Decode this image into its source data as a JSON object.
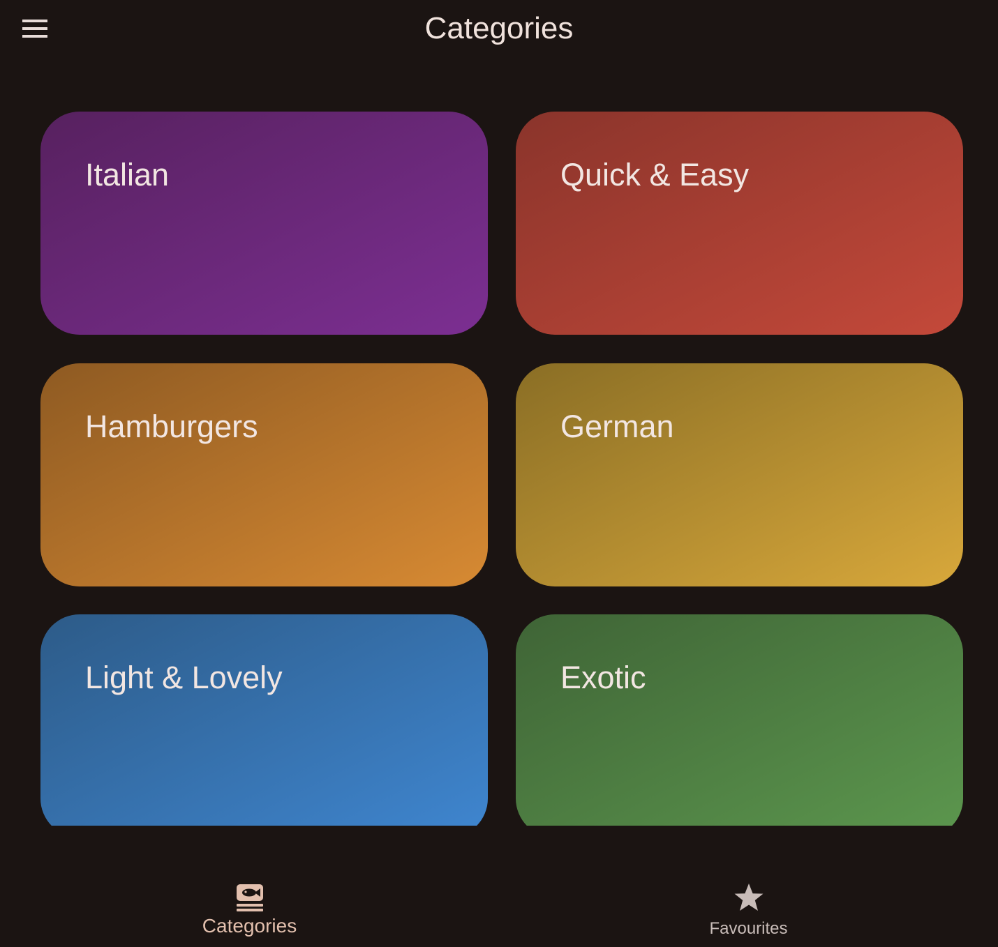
{
  "appbar": {
    "title": "Categories",
    "menu_icon": "menu-icon"
  },
  "categories": [
    {
      "label": "Italian",
      "colors": [
        "#57215f",
        "#7c2f92"
      ]
    },
    {
      "label": "Quick & Easy",
      "colors": [
        "#8a342b",
        "#c4493a"
      ]
    },
    {
      "label": "Hamburgers",
      "colors": [
        "#8e5a22",
        "#d78a33"
      ]
    },
    {
      "label": "German",
      "colors": [
        "#8a6e25",
        "#d8a83b"
      ]
    },
    {
      "label": "Light & Lovely",
      "colors": [
        "#2d5b88",
        "#3f86d0"
      ]
    },
    {
      "label": "Exotic",
      "colors": [
        "#3f6436",
        "#5c974e"
      ]
    }
  ],
  "bottom_nav": {
    "items": [
      {
        "label": "Categories",
        "icon": "set-meal-icon",
        "active": true
      },
      {
        "label": "Favourites",
        "icon": "star-icon",
        "active": false
      }
    ]
  },
  "colors": {
    "background": "#1b1412",
    "text": "#f0e2dc",
    "nav_active": "#e3c0ae",
    "nav_inactive": "#c8bcb8"
  }
}
